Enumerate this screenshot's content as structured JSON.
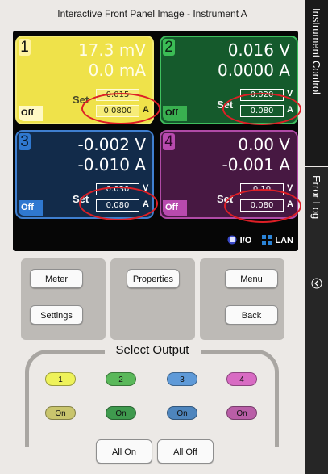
{
  "window": {
    "title": "Interactive Front Panel Image - Instrument A"
  },
  "channels": [
    {
      "number": "1",
      "voltage": "17.3 mV",
      "current": "0.0 mA",
      "set_label": "Set",
      "set_voltage": "0.015",
      "set_current": "0.0800",
      "unit_v": "V",
      "unit_a": "A",
      "state": "Off"
    },
    {
      "number": "2",
      "voltage": "0.016 V",
      "current": "0.0000 A",
      "set_label": "Set",
      "set_voltage": "0.020",
      "set_current": "0.080",
      "unit_v": "V",
      "unit_a": "A",
      "state": "Off"
    },
    {
      "number": "3",
      "voltage": "-0.002 V",
      "current": "-0.010 A",
      "set_label": "Set",
      "set_voltage": "0.030",
      "set_current": "0.080",
      "unit_v": "V",
      "unit_a": "A",
      "state": "Off"
    },
    {
      "number": "4",
      "voltage": "0.00 V",
      "current": "-0.001 A",
      "set_label": "Set",
      "set_voltage": "0.10",
      "set_current": "0.080",
      "unit_v": "V",
      "unit_a": "A",
      "state": "Off"
    }
  ],
  "status": {
    "io": "I/O",
    "lan": "LAN"
  },
  "side_tabs": {
    "instrument_control": "Instrument Control",
    "error_log": "Error Log"
  },
  "buttons": {
    "meter": "Meter",
    "settings": "Settings",
    "properties": "Properties",
    "menu": "Menu",
    "back": "Back"
  },
  "select_output": {
    "label": "Select Output",
    "outputs": [
      "1",
      "2",
      "3",
      "4"
    ],
    "on_labels": [
      "On",
      "On",
      "On",
      "On"
    ],
    "all_on": "All On",
    "all_off": "All Off"
  },
  "colors": {
    "ch1": "#efe24a",
    "ch2": "#155a2c",
    "ch3": "#122b4a",
    "ch4": "#471842",
    "highlight": "#dd1f26"
  }
}
